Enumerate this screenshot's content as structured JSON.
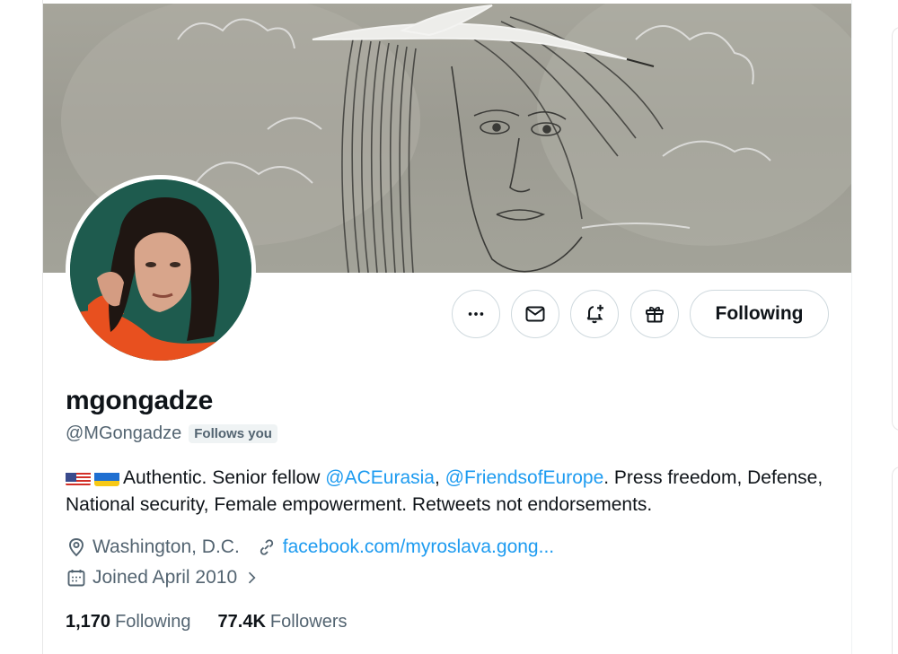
{
  "profile": {
    "display_name": "mgongadze",
    "handle": "@MGongadze",
    "follows_you": "Follows you",
    "bio": {
      "prefix": "Authentic. Senior fellow ",
      "mention1": "@ACEurasia",
      "separator": ", ",
      "mention2": "@FriendsofEurope",
      "suffix": ". Press freedom, Defense, National security, Female empowerment. Retweets not endorsements."
    },
    "location": "Washington, D.C.",
    "website": "facebook.com/myroslava.gong...",
    "joined": "Joined April 2010",
    "stats": {
      "following_count": "1,170",
      "following_label": "Following",
      "followers_count": "77.4K",
      "followers_label": "Followers"
    }
  },
  "actions": {
    "more_icon": "more-horizontal-icon",
    "message_icon": "mail-icon",
    "notify_icon": "bell-plus-icon",
    "gift_icon": "gift-icon",
    "following_label": "Following"
  },
  "colors": {
    "link": "#1d9bf0",
    "muted": "#536471",
    "text": "#0f1419",
    "border": "#cfd9de"
  }
}
